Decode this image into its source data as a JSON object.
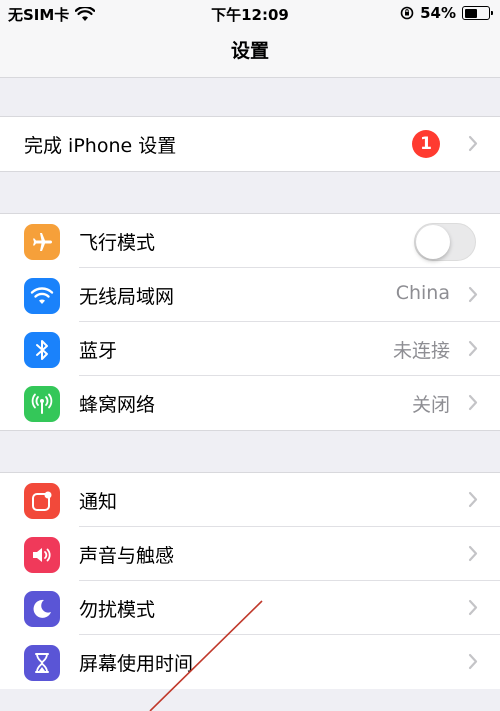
{
  "status_bar": {
    "carrier": "无SIM卡",
    "time": "下午12:09",
    "battery": "54%",
    "battery_level": 0.54
  },
  "nav": {
    "title": "设置"
  },
  "setup": {
    "label": "完成 iPhone 设置",
    "badge": "1"
  },
  "network": {
    "airplane": {
      "label": "飞行模式",
      "on": false
    },
    "wifi": {
      "label": "无线局域网",
      "value": "China"
    },
    "bluetooth": {
      "label": "蓝牙",
      "value": "未连接"
    },
    "cellular": {
      "label": "蜂窝网络",
      "value": "关闭"
    }
  },
  "general": {
    "notifications": {
      "label": "通知"
    },
    "sounds": {
      "label": "声音与触感"
    },
    "dnd": {
      "label": "勿扰模式"
    },
    "screen_time": {
      "label": "屏幕使用时间"
    }
  },
  "colors": {
    "airplane": "#f6a03a",
    "wifi": "#1a82fb",
    "bluetooth": "#1a82fb",
    "cellular": "#34c759",
    "notifications": "#f2493a",
    "sounds": "#f0395a",
    "dnd": "#5a55d6",
    "screen_time": "#5a55d6"
  }
}
